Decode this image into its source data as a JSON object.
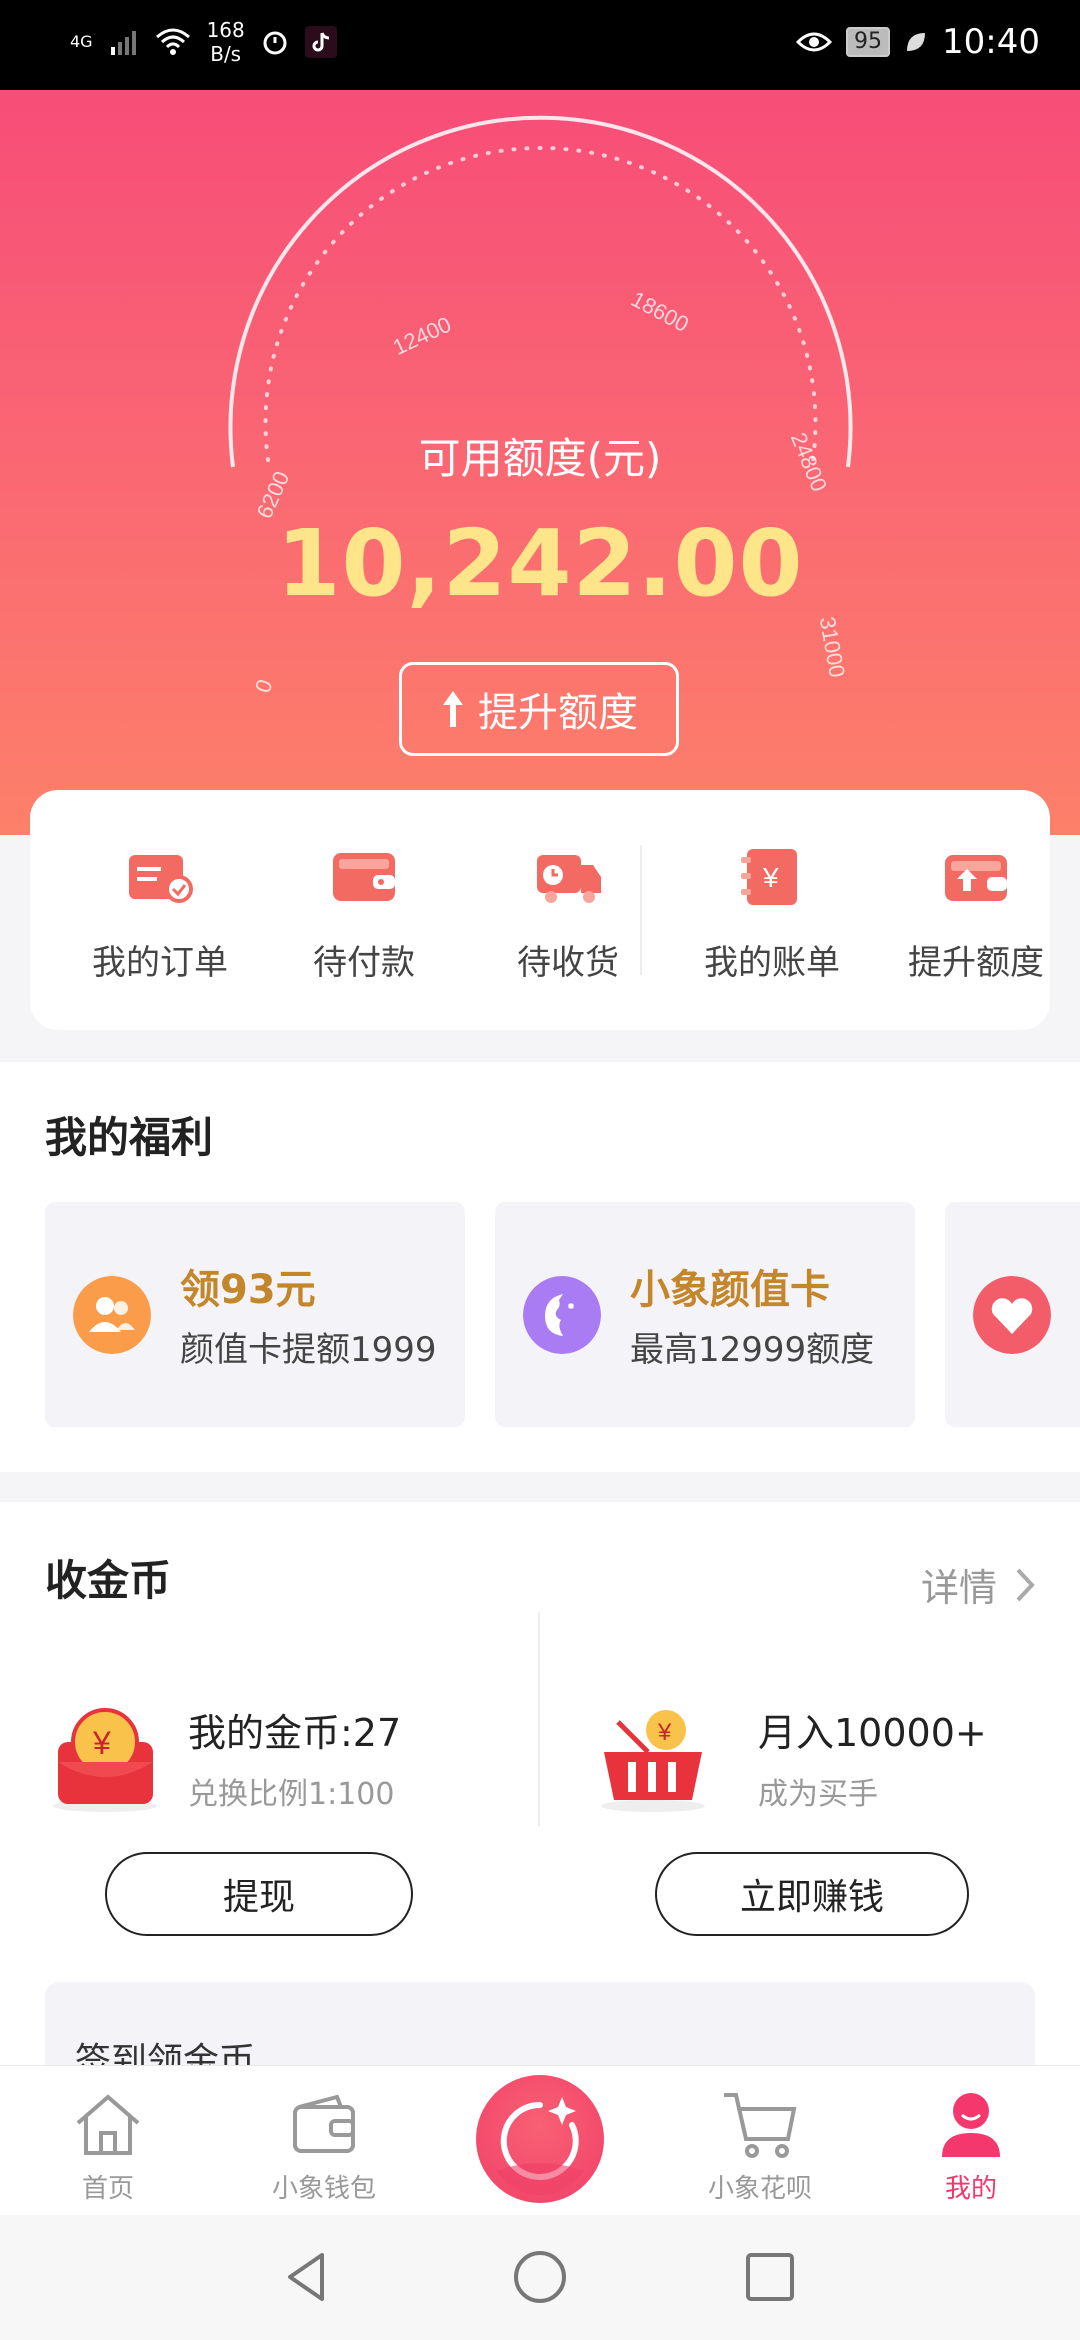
{
  "status_bar": {
    "network": "4G",
    "speed_value": "168",
    "speed_unit": "B/s",
    "battery": "95",
    "time": "10:40",
    "icons": [
      "signal-icon",
      "wifi-icon",
      "alarm-icon",
      "tiktok-icon",
      "eye-icon",
      "battery-icon",
      "leaf-icon"
    ]
  },
  "hero": {
    "gauge_ticks": [
      "0",
      "6200",
      "12400",
      "18600",
      "24800",
      "31000"
    ],
    "title": "可用额度(元)",
    "amount": "10,242.00",
    "raise_button": "提升额度",
    "colors": {
      "gradient_top": "#f74d78",
      "gradient_bottom": "#fd806a",
      "amount": "#ffe58a"
    }
  },
  "quick_actions": [
    {
      "label": "我的订单",
      "icon": "order-icon"
    },
    {
      "label": "待付款",
      "icon": "wallet-icon"
    },
    {
      "label": "待收货",
      "icon": "delivery-truck-icon"
    },
    {
      "label": "我的账单",
      "icon": "bill-icon"
    },
    {
      "label": "提升额度",
      "icon": "raise-limit-icon"
    }
  ],
  "welfare": {
    "title": "我的福利",
    "cards": [
      {
        "title": "领93元",
        "subtitle": "颜值卡提额1999",
        "icon": "users-icon"
      },
      {
        "title": "小象颜值卡",
        "subtitle": "最高12999额度",
        "icon": "face-icon"
      },
      {
        "title": "",
        "subtitle": "",
        "icon": "heart-icon"
      }
    ]
  },
  "coins": {
    "title": "收金币",
    "detail": "详情",
    "left": {
      "title": "我的金币:27",
      "subtitle": "兑换比例1:100",
      "button": "提现",
      "icon": "red-envelope-coin-icon"
    },
    "right": {
      "title": "月入10000+",
      "subtitle": "成为买手",
      "button": "立即赚钱",
      "icon": "shopping-basket-icon"
    },
    "checkin": "签到领金币"
  },
  "tab_bar": [
    {
      "label": "首页",
      "icon": "home-icon",
      "active": false
    },
    {
      "label": "小象钱包",
      "icon": "wallet-icon",
      "active": false
    },
    {
      "label": "",
      "icon": "center-logo-icon",
      "active": false
    },
    {
      "label": "小象花呗",
      "icon": "cart-icon",
      "active": false
    },
    {
      "label": "我的",
      "icon": "profile-icon",
      "active": true
    }
  ],
  "nav_bar": [
    "back-icon",
    "home-circle-icon",
    "recents-icon"
  ]
}
